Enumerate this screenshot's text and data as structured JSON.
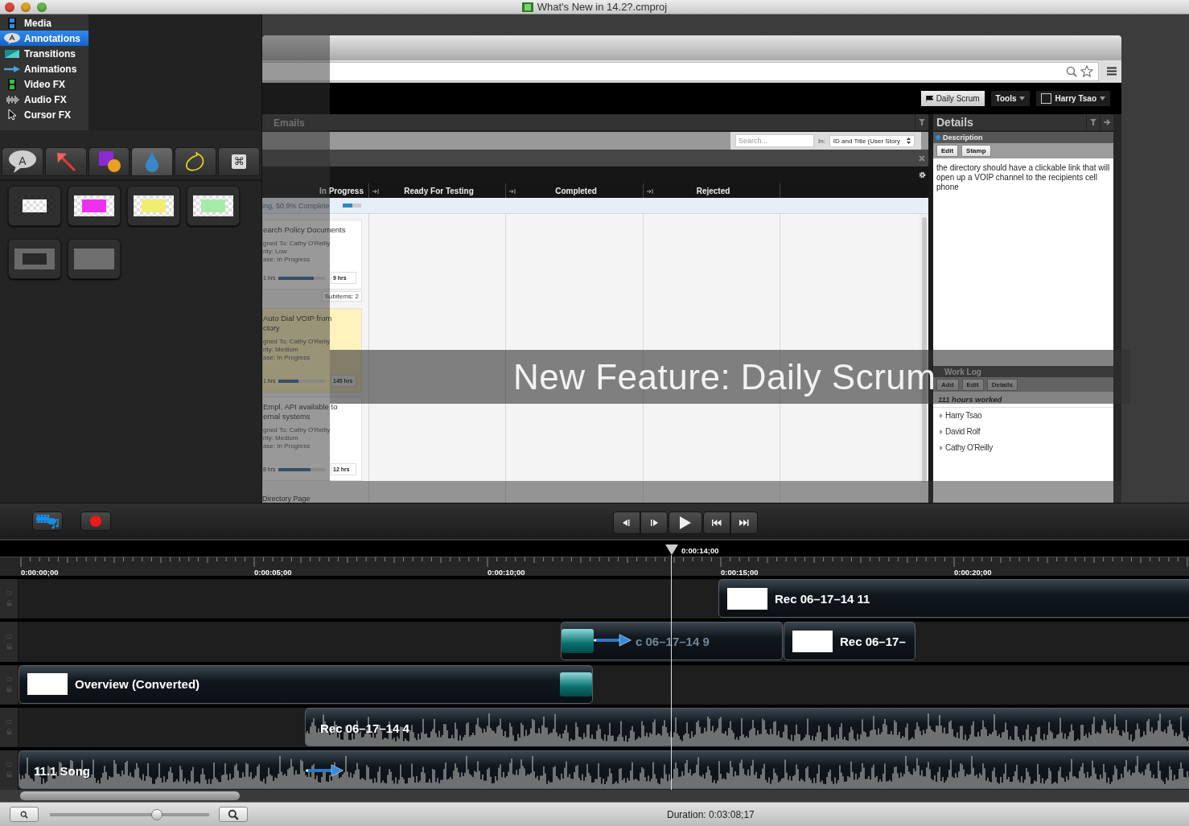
{
  "window": {
    "title": "What's New in 14.2?.cmproj"
  },
  "sidebar": {
    "items": [
      {
        "label": "Media",
        "selected": false
      },
      {
        "label": "Annotations",
        "selected": true
      },
      {
        "label": "Transitions",
        "selected": false
      },
      {
        "label": "Animations",
        "selected": false
      },
      {
        "label": "Video FX",
        "selected": false
      },
      {
        "label": "Audio FX",
        "selected": false
      },
      {
        "label": "Cursor FX",
        "selected": false
      }
    ]
  },
  "annotation_tools": {
    "tabs": [
      {
        "kind": "callout",
        "label": "A",
        "selected": false
      },
      {
        "kind": "arrow",
        "selected": false
      },
      {
        "kind": "shapes",
        "selected": false
      },
      {
        "kind": "blur",
        "selected": true
      },
      {
        "kind": "sketch",
        "selected": false
      },
      {
        "kind": "keystroke",
        "label": "⌘",
        "selected": false
      }
    ],
    "styles": [
      {
        "kind": "frame"
      },
      {
        "kind": "tint",
        "color": "#f030f0"
      },
      {
        "kind": "tint",
        "color": "#eeee70"
      },
      {
        "kind": "tint",
        "color": "#a8eaa8"
      },
      {
        "kind": "outline"
      },
      {
        "kind": "solid"
      }
    ]
  },
  "preview": {
    "caption": "New Feature: Daily Scrum",
    "web_page": {
      "header_buttons": [
        {
          "kind": "flag",
          "label": "Daily Scrum"
        },
        {
          "kind": "menu",
          "label": "Tools"
        },
        {
          "kind": "user",
          "label": "Harry Tsao"
        }
      ],
      "board": {
        "tab": "Emails",
        "search": {
          "placeholder": "Search..."
        },
        "in_label": "In:",
        "in_value": "ID and Title (User Story",
        "columns": [
          "In Progress",
          "Ready For Testing",
          "Completed",
          "Rejected"
        ],
        "summary": {
          "text": "ing, 50.9% Complete",
          "level": 0.52
        },
        "cards": [
          {
            "title_lines": [
              "earch Policy Documents"
            ],
            "details": [
              "gned To: Cathy O'Reilly",
              "rity: Low",
              "ase: In Progress"
            ],
            "done": "1 hrs",
            "level": 0.76,
            "remaining": "9 hrs",
            "highlighted": false,
            "subitems": "Subitems: 2"
          },
          {
            "title_lines": [
              "Auto Dial VOIP from",
              "ctory"
            ],
            "details": [
              "gned To: Cathy O'Reilly",
              "rity: Medium",
              "ase: In Progress"
            ],
            "done": "1 hrs",
            "level": 0.43,
            "remaining": "145 hrs",
            "highlighted": true
          },
          {
            "title_lines": [
              "Empl. API available to",
              "ernal systems"
            ],
            "details": [
              "gned To: Cathy O'Reilly",
              "rity: Medium",
              "ase: In Progress"
            ],
            "done": "8 hrs",
            "level": 0.69,
            "remaining": "12 hrs",
            "highlighted": false
          }
        ],
        "footer_item": "Directory Page"
      },
      "details": {
        "title": "Details",
        "section": "Description",
        "buttons": [
          "Edit",
          "Stamp"
        ],
        "text": "the directory should have a clickable link that will open up a VOIP channel to the recipients cell phone",
        "work_log": {
          "title": "Work Log",
          "buttons": [
            "Add",
            "Edit",
            "Details"
          ],
          "total": "111 hours worked",
          "people": [
            "Harry Tsao",
            "David Rolf",
            "Cathy O'Reilly"
          ]
        }
      }
    }
  },
  "timeline": {
    "playhead": "0:00:14;00",
    "ruler_labels": [
      "0:00:00;00",
      "0:00:05;00",
      "0:00:10;00",
      "0:00:15;00",
      "0:00:20;00"
    ],
    "tracks": [
      {
        "clips": [
          {
            "kind": "video",
            "label": "Rec 06–17–14 11",
            "dimmed": false,
            "transition_in": false,
            "transition_out": false,
            "animation": false
          }
        ]
      },
      {
        "clips": [
          {
            "kind": "video",
            "label": "c 06–17–14 9",
            "dimmed": true,
            "transition_in": true,
            "transition_out": false,
            "animation": true
          },
          {
            "kind": "video",
            "label": "Rec 06–17–",
            "dimmed": false,
            "transition_in": false,
            "transition_out": false,
            "animation": false
          }
        ]
      },
      {
        "clips": [
          {
            "kind": "video",
            "label": "Overview (Converted)",
            "dimmed": false,
            "transition_in": false,
            "transition_out": true,
            "animation": false
          }
        ]
      },
      {
        "clips": [
          {
            "kind": "audio",
            "label": "Rec 06–17–14 4",
            "dimmed": false,
            "transition_in": false,
            "transition_out": false,
            "animation": false
          }
        ]
      },
      {
        "clips": [
          {
            "kind": "audio",
            "label": "11.1 Song",
            "dimmed": false,
            "transition_in": false,
            "transition_out": false,
            "animation": true
          }
        ]
      }
    ]
  },
  "status_bar": {
    "zoom": {
      "level": 0.67
    },
    "duration": "Duration: 0:03:08;17"
  }
}
